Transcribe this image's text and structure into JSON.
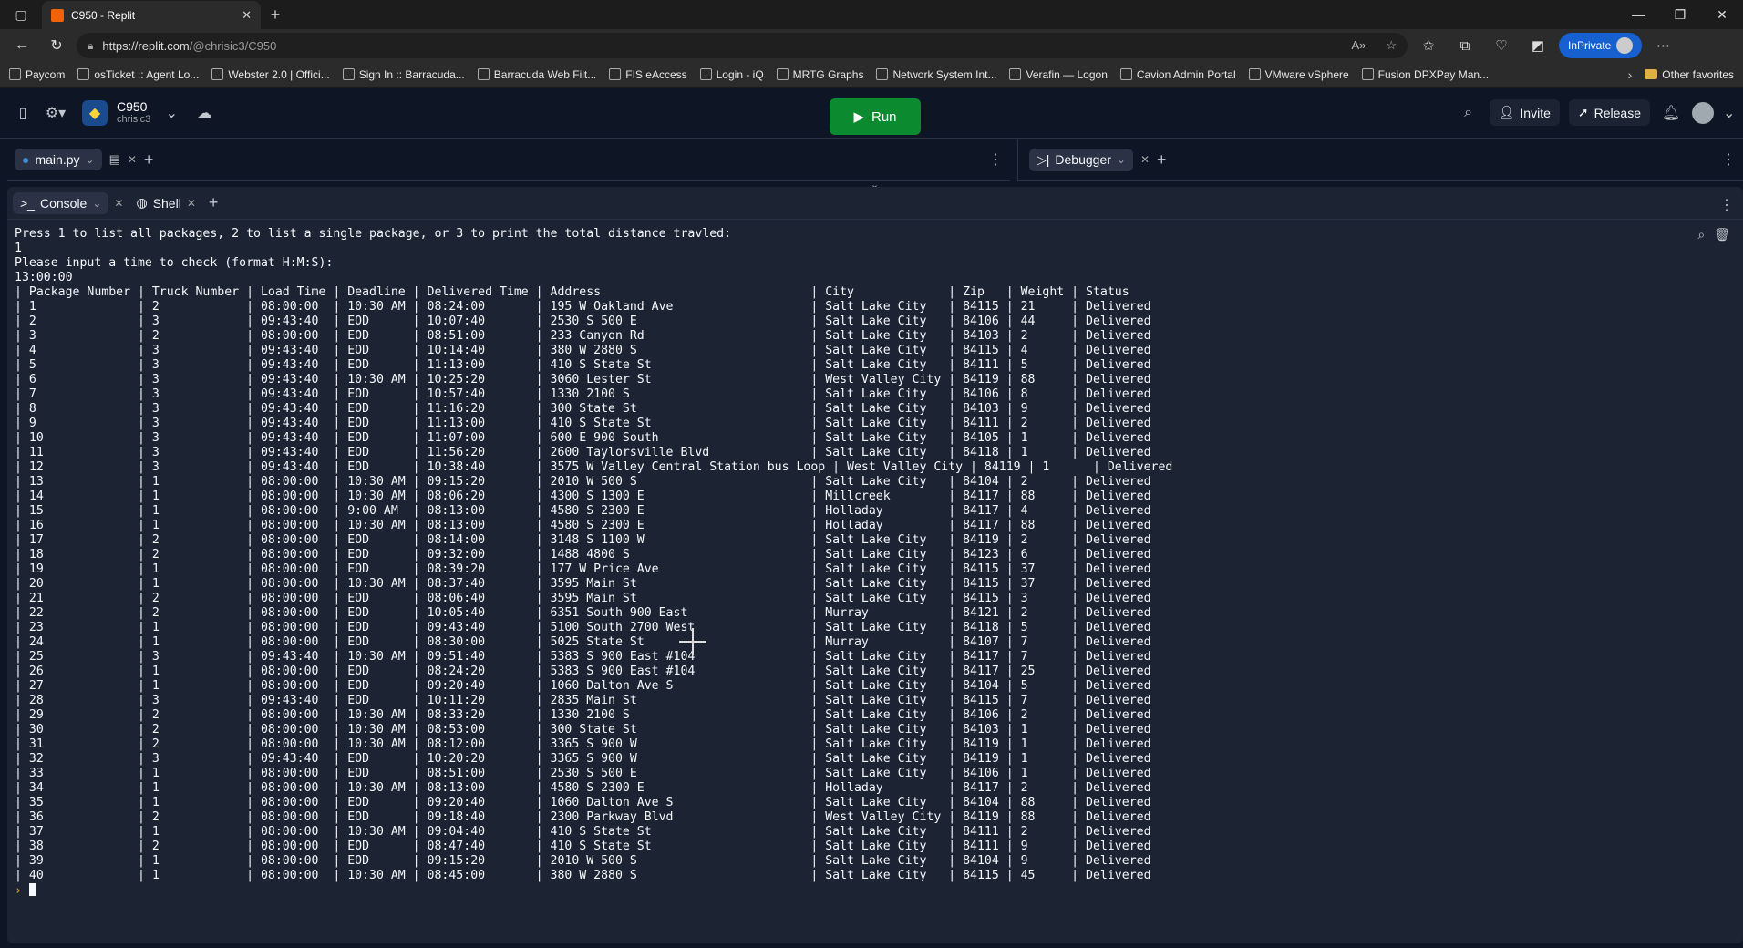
{
  "browser": {
    "tab_title": "C950 - Replit",
    "url_host": "https://replit.com",
    "url_path": "/@chrisic3/C950",
    "inprivate_label": "InPrivate",
    "bookmarks": [
      "Paycom",
      "osTicket :: Agent Lo...",
      "Webster 2.0 | Offici...",
      "Sign In :: Barracuda...",
      "Barracuda Web Filt...",
      "FIS eAccess",
      "Login - iQ",
      "MRTG Graphs",
      "Network System Int...",
      "Verafin — Logon",
      "Cavion Admin Portal",
      "VMware vSphere",
      "Fusion DPXPay Man..."
    ],
    "other_favorites": "Other favorites"
  },
  "header": {
    "repl_name": "C950",
    "owner": "chrisic3",
    "run_label": "Run",
    "invite_label": "Invite",
    "release_label": "Release"
  },
  "editor": {
    "file_tab": "main.py",
    "debugger_tab": "Debugger"
  },
  "console": {
    "console_tab": "Console",
    "shell_tab": "Shell",
    "lines": [
      "Press 1 to list all packages, 2 to list a single package, or 3 to print the total distance travled:",
      "1",
      "Please input a time to check (format H:M:S):",
      "13:00:00",
      "| Package Number | Truck Number | Load Time | Deadline | Delivered Time | Address                             | City             | Zip   | Weight | Status",
      "| 1              | 2            | 08:00:00  | 10:30 AM | 08:24:00       | 195 W Oakland Ave                   | Salt Lake City   | 84115 | 21     | Delivered",
      "| 2              | 3            | 09:43:40  | EOD      | 10:07:40       | 2530 S 500 E                        | Salt Lake City   | 84106 | 44     | Delivered",
      "| 3              | 2            | 08:00:00  | EOD      | 08:51:00       | 233 Canyon Rd                       | Salt Lake City   | 84103 | 2      | Delivered",
      "| 4              | 3            | 09:43:40  | EOD      | 10:14:40       | 380 W 2880 S                        | Salt Lake City   | 84115 | 4      | Delivered",
      "| 5              | 3            | 09:43:40  | EOD      | 11:13:00       | 410 S State St                      | Salt Lake City   | 84111 | 5      | Delivered",
      "| 6              | 3            | 09:43:40  | 10:30 AM | 10:25:20       | 3060 Lester St                      | West Valley City | 84119 | 88     | Delivered",
      "| 7              | 3            | 09:43:40  | EOD      | 10:57:40       | 1330 2100 S                         | Salt Lake City   | 84106 | 8      | Delivered",
      "| 8              | 3            | 09:43:40  | EOD      | 11:16:20       | 300 State St                        | Salt Lake City   | 84103 | 9      | Delivered",
      "| 9              | 3            | 09:43:40  | EOD      | 11:13:00       | 410 S State St                      | Salt Lake City   | 84111 | 2      | Delivered",
      "| 10             | 3            | 09:43:40  | EOD      | 11:07:00       | 600 E 900 South                     | Salt Lake City   | 84105 | 1      | Delivered",
      "| 11             | 3            | 09:43:40  | EOD      | 11:56:20       | 2600 Taylorsville Blvd              | Salt Lake City   | 84118 | 1      | Delivered",
      "| 12             | 3            | 09:43:40  | EOD      | 10:38:40       | 3575 W Valley Central Station bus Loop | West Valley City | 84119 | 1      | Delivered",
      "| 13             | 1            | 08:00:00  | 10:30 AM | 09:15:20       | 2010 W 500 S                        | Salt Lake City   | 84104 | 2      | Delivered",
      "| 14             | 1            | 08:00:00  | 10:30 AM | 08:06:20       | 4300 S 1300 E                       | Millcreek        | 84117 | 88     | Delivered",
      "| 15             | 1            | 08:00:00  | 9:00 AM  | 08:13:00       | 4580 S 2300 E                       | Holladay         | 84117 | 4      | Delivered",
      "| 16             | 1            | 08:00:00  | 10:30 AM | 08:13:00       | 4580 S 2300 E                       | Holladay         | 84117 | 88     | Delivered",
      "| 17             | 2            | 08:00:00  | EOD      | 08:14:00       | 3148 S 1100 W                       | Salt Lake City   | 84119 | 2      | Delivered",
      "| 18             | 2            | 08:00:00  | EOD      | 09:32:00       | 1488 4800 S                         | Salt Lake City   | 84123 | 6      | Delivered",
      "| 19             | 1            | 08:00:00  | EOD      | 08:39:20       | 177 W Price Ave                     | Salt Lake City   | 84115 | 37     | Delivered",
      "| 20             | 1            | 08:00:00  | 10:30 AM | 08:37:40       | 3595 Main St                        | Salt Lake City   | 84115 | 37     | Delivered",
      "| 21             | 2            | 08:00:00  | EOD      | 08:06:40       | 3595 Main St                        | Salt Lake City   | 84115 | 3      | Delivered",
      "| 22             | 2            | 08:00:00  | EOD      | 10:05:40       | 6351 South 900 East                 | Murray           | 84121 | 2      | Delivered",
      "| 23             | 1            | 08:00:00  | EOD      | 09:43:40       | 5100 South 2700 West                | Salt Lake City   | 84118 | 5      | Delivered",
      "| 24             | 1            | 08:00:00  | EOD      | 08:30:00       | 5025 State St                       | Murray           | 84107 | 7      | Delivered",
      "| 25             | 3            | 09:43:40  | 10:30 AM | 09:51:40       | 5383 S 900 East #104                | Salt Lake City   | 84117 | 7      | Delivered",
      "| 26             | 1            | 08:00:00  | EOD      | 08:24:20       | 5383 S 900 East #104                | Salt Lake City   | 84117 | 25     | Delivered",
      "| 27             | 1            | 08:00:00  | EOD      | 09:20:40       | 1060 Dalton Ave S                   | Salt Lake City   | 84104 | 5      | Delivered",
      "| 28             | 3            | 09:43:40  | EOD      | 10:11:20       | 2835 Main St                        | Salt Lake City   | 84115 | 7      | Delivered",
      "| 29             | 2            | 08:00:00  | 10:30 AM | 08:33:20       | 1330 2100 S                         | Salt Lake City   | 84106 | 2      | Delivered",
      "| 30             | 2            | 08:00:00  | 10:30 AM | 08:53:00       | 300 State St                        | Salt Lake City   | 84103 | 1      | Delivered",
      "| 31             | 2            | 08:00:00  | 10:30 AM | 08:12:00       | 3365 S 900 W                        | Salt Lake City   | 84119 | 1      | Delivered",
      "| 32             | 3            | 09:43:40  | EOD      | 10:20:20       | 3365 S 900 W                        | Salt Lake City   | 84119 | 1      | Delivered",
      "| 33             | 1            | 08:00:00  | EOD      | 08:51:00       | 2530 S 500 E                        | Salt Lake City   | 84106 | 1      | Delivered",
      "| 34             | 1            | 08:00:00  | 10:30 AM | 08:13:00       | 4580 S 2300 E                       | Holladay         | 84117 | 2      | Delivered",
      "| 35             | 1            | 08:00:00  | EOD      | 09:20:40       | 1060 Dalton Ave S                   | Salt Lake City   | 84104 | 88     | Delivered",
      "| 36             | 2            | 08:00:00  | EOD      | 09:18:40       | 2300 Parkway Blvd                   | West Valley City | 84119 | 88     | Delivered",
      "| 37             | 1            | 08:00:00  | 10:30 AM | 09:04:40       | 410 S State St                      | Salt Lake City   | 84111 | 2      | Delivered",
      "| 38             | 2            | 08:00:00  | EOD      | 08:47:40       | 410 S State St                      | Salt Lake City   | 84111 | 9      | Delivered",
      "| 39             | 1            | 08:00:00  | EOD      | 09:15:20       | 2010 W 500 S                        | Salt Lake City   | 84104 | 9      | Delivered",
      "| 40             | 1            | 08:00:00  | 10:30 AM | 08:45:00       | 380 W 2880 S                        | Salt Lake City   | 84115 | 45     | Delivered"
    ]
  }
}
